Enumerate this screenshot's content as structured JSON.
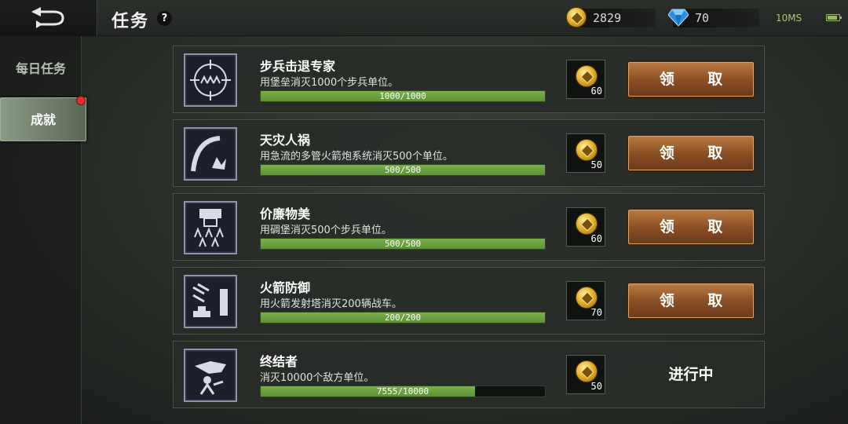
{
  "header": {
    "title": "任务",
    "help": "?",
    "gold": "2829",
    "gems": "70",
    "network": "10MS"
  },
  "sidebar": {
    "items": [
      {
        "label": "每日任务"
      },
      {
        "label": "成就"
      }
    ]
  },
  "tasks": [
    {
      "name": "步兵击退专家",
      "desc": "用堡垒消灭1000个步兵单位。",
      "progress_text": "1000/1000",
      "progress": 1.0,
      "reward": "60",
      "action": "领 取",
      "icon": "crosshair-infantry-icon"
    },
    {
      "name": "天灾人祸",
      "desc": "用急流的多管火箭炮系统消灭500个单位。",
      "progress_text": "500/500",
      "progress": 1.0,
      "reward": "50",
      "action": "领 取",
      "icon": "rocket-barrage-icon"
    },
    {
      "name": "价廉物美",
      "desc": "用碉堡消灭500个步兵单位。",
      "progress_text": "500/500",
      "progress": 1.0,
      "reward": "60",
      "action": "领 取",
      "icon": "bunker-infantry-icon"
    },
    {
      "name": "火箭防御",
      "desc": "用火箭发射塔消灭200辆战车。",
      "progress_text": "200/200",
      "progress": 1.0,
      "reward": "70",
      "action": "领 取",
      "icon": "rocket-tower-icon"
    },
    {
      "name": "终结者",
      "desc": "消灭10000个敌方单位。",
      "progress_text": "7555/10000",
      "progress": 0.7555,
      "reward": "50",
      "status": "进行中",
      "icon": "terminator-soldier-icon"
    }
  ]
}
